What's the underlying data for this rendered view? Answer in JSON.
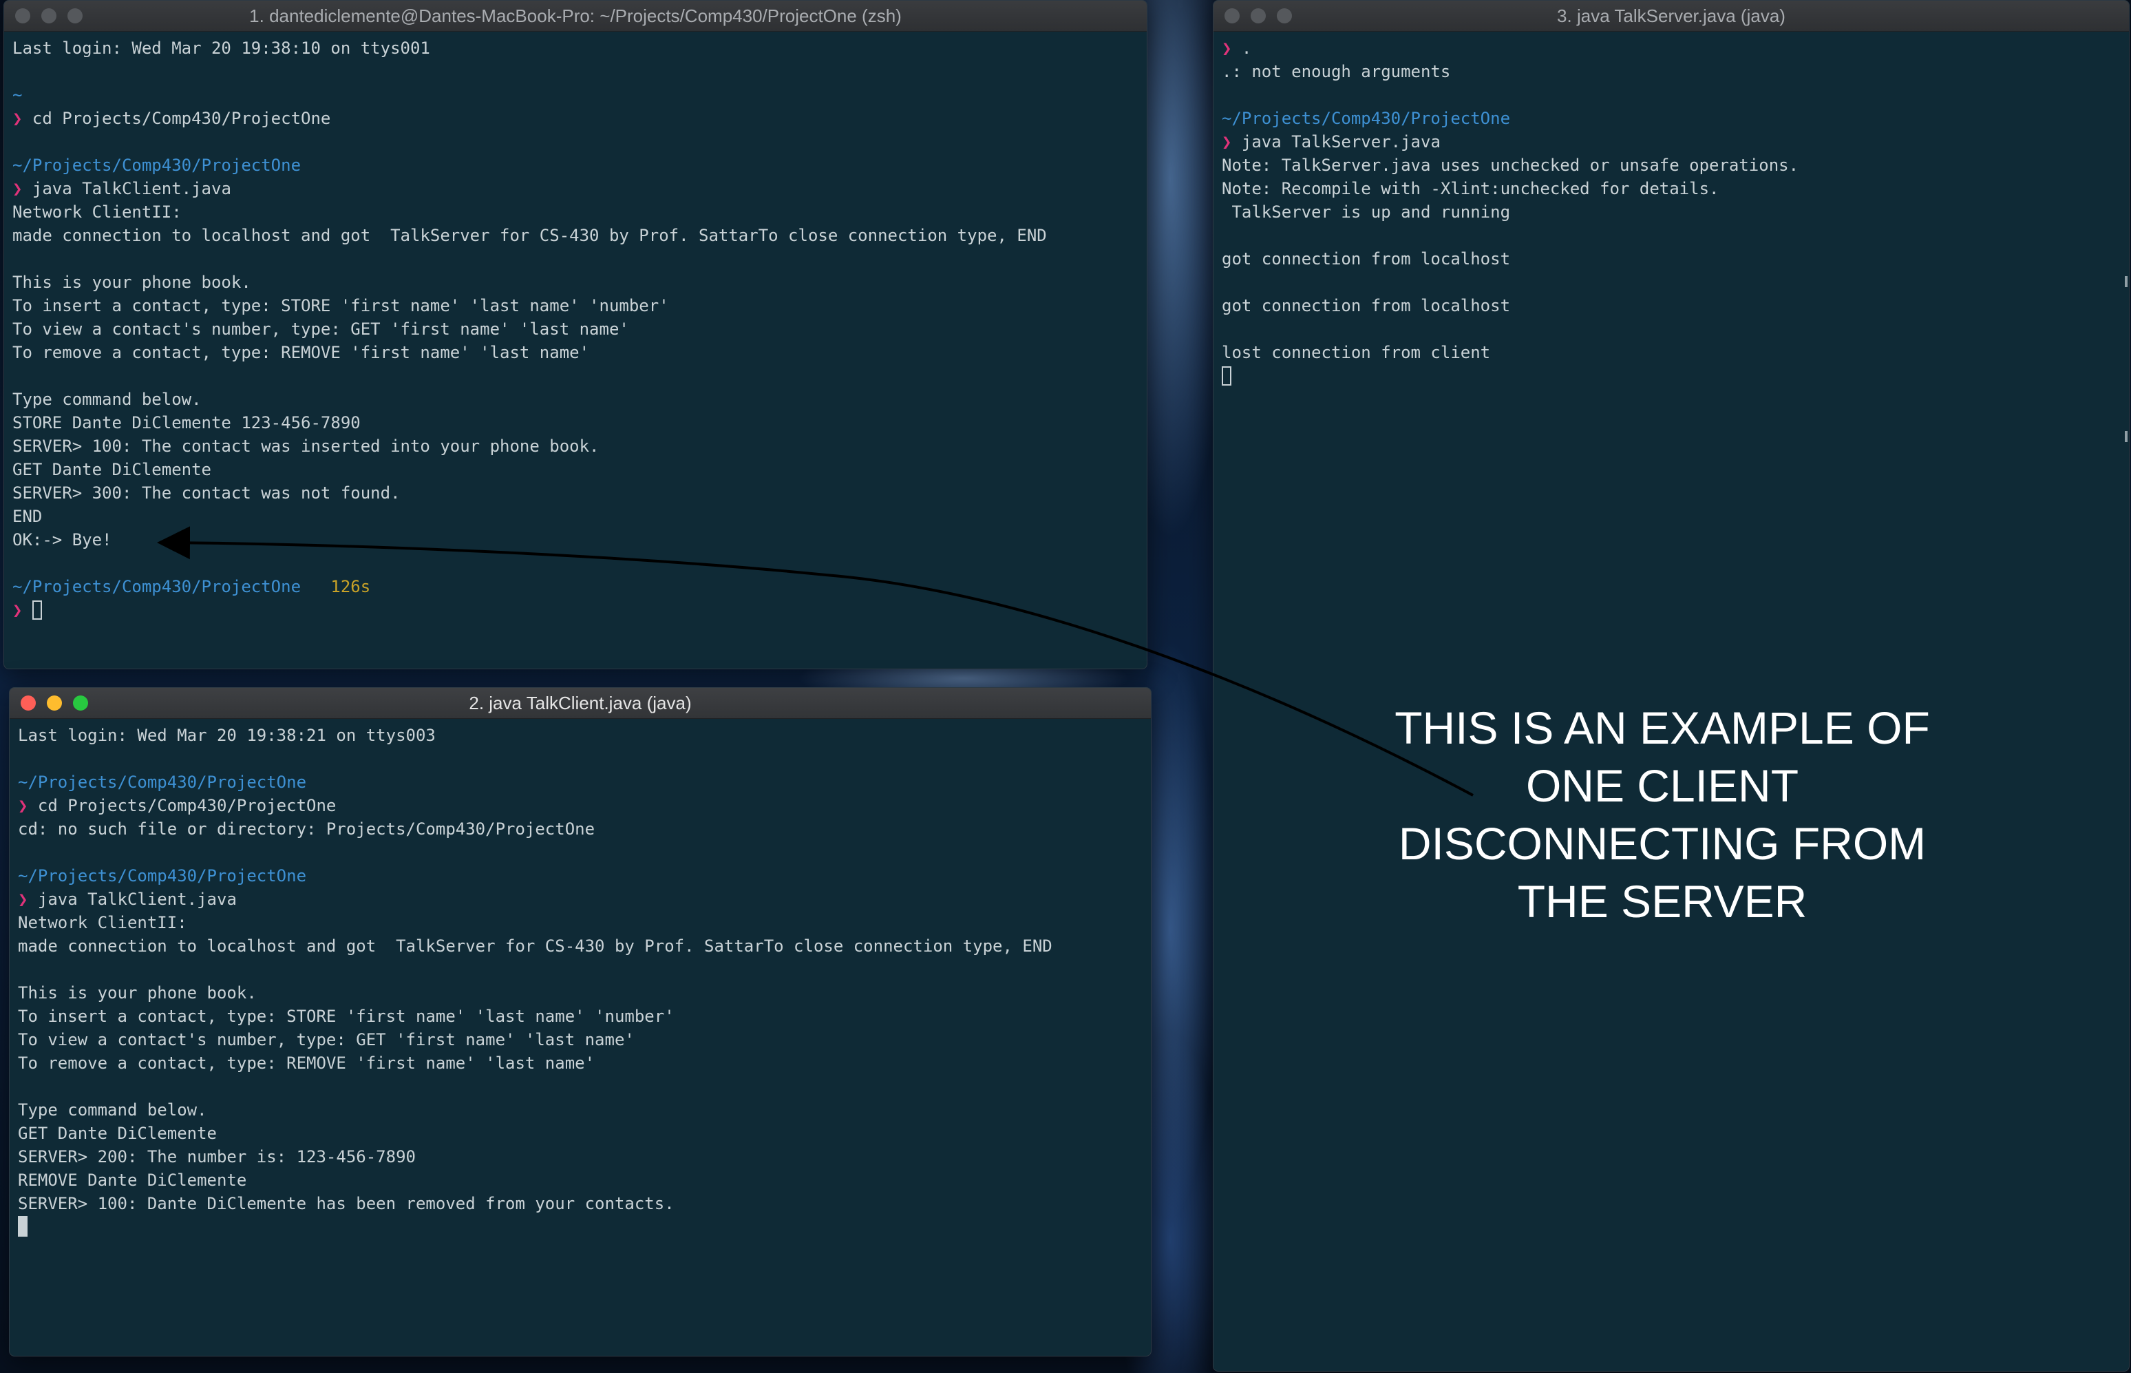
{
  "windows": {
    "client1": {
      "title": "1. dantediclemente@Dantes-MacBook-Pro: ~/Projects/Comp430/ProjectOne (zsh)",
      "lines": [
        {
          "text": "Last login: Wed Mar 20 19:38:10 on ttys001"
        },
        {
          "text": ""
        },
        {
          "path": "~"
        },
        {
          "prompt": "❯",
          "text": " cd Projects/Comp430/ProjectOne"
        },
        {
          "text": ""
        },
        {
          "path": "~/Projects/Comp430/ProjectOne"
        },
        {
          "prompt": "❯",
          "text": " java TalkClient.java"
        },
        {
          "text": "Network ClientII:"
        },
        {
          "text": "made connection to localhost and got  TalkServer for CS-430 by Prof. SattarTo close connection type, END"
        },
        {
          "text": ""
        },
        {
          "text": "This is your phone book."
        },
        {
          "text": "To insert a contact, type: STORE 'first name' 'last name' 'number'"
        },
        {
          "text": "To view a contact's number, type: GET 'first name' 'last name'"
        },
        {
          "text": "To remove a contact, type: REMOVE 'first name' 'last name'"
        },
        {
          "text": ""
        },
        {
          "text": "Type command below."
        },
        {
          "text": "STORE Dante DiClemente 123-456-7890"
        },
        {
          "text": "SERVER> 100: The contact was inserted into your phone book."
        },
        {
          "text": "GET Dante DiClemente"
        },
        {
          "text": "SERVER> 300: The contact was not found."
        },
        {
          "text": "END"
        },
        {
          "text": "OK:-> Bye!"
        },
        {
          "text": ""
        },
        {
          "path": "~/Projects/Comp430/ProjectOne",
          "timing": "126s"
        },
        {
          "prompt": "❯",
          "cursor": "hollow"
        }
      ]
    },
    "client2": {
      "title": "2. java TalkClient.java (java)",
      "lines": [
        {
          "text": "Last login: Wed Mar 20 19:38:21 on ttys003"
        },
        {
          "text": ""
        },
        {
          "path": "~/Projects/Comp430/ProjectOne"
        },
        {
          "prompt": "❯",
          "text": " cd Projects/Comp430/ProjectOne"
        },
        {
          "text": "cd: no such file or directory: Projects/Comp430/ProjectOne"
        },
        {
          "text": ""
        },
        {
          "path": "~/Projects/Comp430/ProjectOne"
        },
        {
          "prompt": "❯",
          "text": " java TalkClient.java"
        },
        {
          "text": "Network ClientII:"
        },
        {
          "text": "made connection to localhost and got  TalkServer for CS-430 by Prof. SattarTo close connection type, END"
        },
        {
          "text": ""
        },
        {
          "text": "This is your phone book."
        },
        {
          "text": "To insert a contact, type: STORE 'first name' 'last name' 'number'"
        },
        {
          "text": "To view a contact's number, type: GET 'first name' 'last name'"
        },
        {
          "text": "To remove a contact, type: REMOVE 'first name' 'last name'"
        },
        {
          "text": ""
        },
        {
          "text": "Type command below."
        },
        {
          "text": "GET Dante DiClemente"
        },
        {
          "text": "SERVER> 200: The number is: 123-456-7890"
        },
        {
          "text": "REMOVE Dante DiClemente"
        },
        {
          "text": "SERVER> 100: Dante DiClemente has been removed from your contacts."
        },
        {
          "cursor": "block"
        }
      ]
    },
    "server": {
      "title": "3. java TalkServer.java (java)",
      "lines": [
        {
          "prompt": "❯",
          "text": " ."
        },
        {
          "text": ".: not enough arguments"
        },
        {
          "text": ""
        },
        {
          "path": "~/Projects/Comp430/ProjectOne"
        },
        {
          "prompt": "❯",
          "text": " java TalkServer.java"
        },
        {
          "text": "Note: TalkServer.java uses unchecked or unsafe operations."
        },
        {
          "text": "Note: Recompile with -Xlint:unchecked for details."
        },
        {
          "text": " TalkServer is up and running"
        },
        {
          "text": ""
        },
        {
          "text": "got connection from localhost"
        },
        {
          "text": ""
        },
        {
          "text": "got connection from localhost"
        },
        {
          "text": ""
        },
        {
          "text": "lost connection from client"
        },
        {
          "cursor": "hollow"
        }
      ]
    }
  },
  "annotation": {
    "lines": [
      "THIS IS AN EXAMPLE OF",
      "ONE CLIENT",
      "DISCONNECTING FROM",
      "THE SERVER"
    ]
  },
  "colors": {
    "terminal_bg": "#0f2a36",
    "text": "#c9d2d6",
    "path": "#3e91d4",
    "prompt": "#e0337a",
    "timing": "#c9a227"
  }
}
